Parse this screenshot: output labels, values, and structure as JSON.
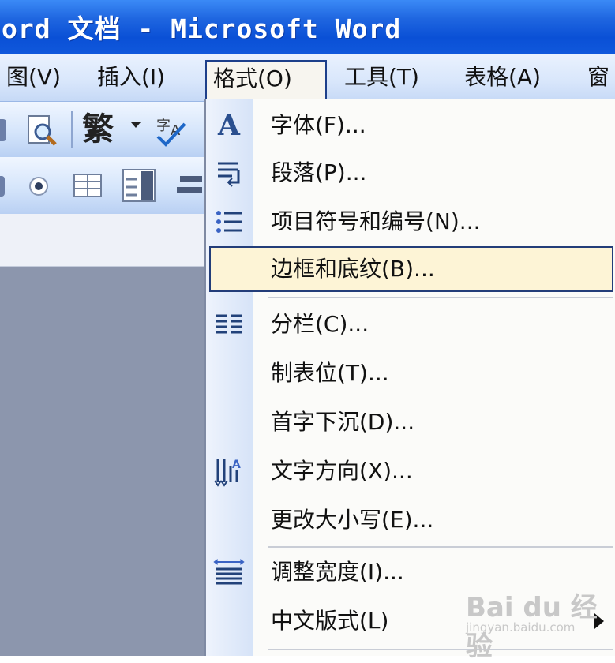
{
  "window": {
    "title": "ord 文档 - Microsoft Word"
  },
  "menubar": {
    "items": [
      {
        "label": "图(V)"
      },
      {
        "label": "插入(I)"
      },
      {
        "label": "格式(O)"
      },
      {
        "label": "工具(T)"
      },
      {
        "label": "表格(A)"
      },
      {
        "label": "窗"
      }
    ]
  },
  "toolbar": {
    "traditional_glyph": "繁"
  },
  "format_menu": {
    "items": [
      {
        "label": "字体(F)...",
        "icon": "font-A-icon"
      },
      {
        "label": "段落(P)...",
        "icon": "paragraph-icon"
      },
      {
        "label": "项目符号和编号(N)...",
        "icon": "bullets-icon"
      },
      {
        "label": "边框和底纹(B)...",
        "icon": "",
        "highlighted": true
      },
      {
        "label": "分栏(C)...",
        "icon": "columns-icon"
      },
      {
        "label": "制表位(T)...",
        "icon": ""
      },
      {
        "label": "首字下沉(D)...",
        "icon": ""
      },
      {
        "label": "文字方向(X)...",
        "icon": "text-direction-icon"
      },
      {
        "label": "更改大小写(E)...",
        "icon": ""
      },
      {
        "label": "调整宽度(I)...",
        "icon": "fit-width-icon"
      },
      {
        "label": "中文版式(L)",
        "icon": "",
        "submenu": true
      }
    ]
  },
  "watermark": {
    "text": "Bai du 经验",
    "subtext": "jingyan.baidu.com"
  },
  "colors": {
    "title_bar": "#0a50d6",
    "highlight": "#fdf4d6",
    "highlight_border": "#233d79"
  }
}
